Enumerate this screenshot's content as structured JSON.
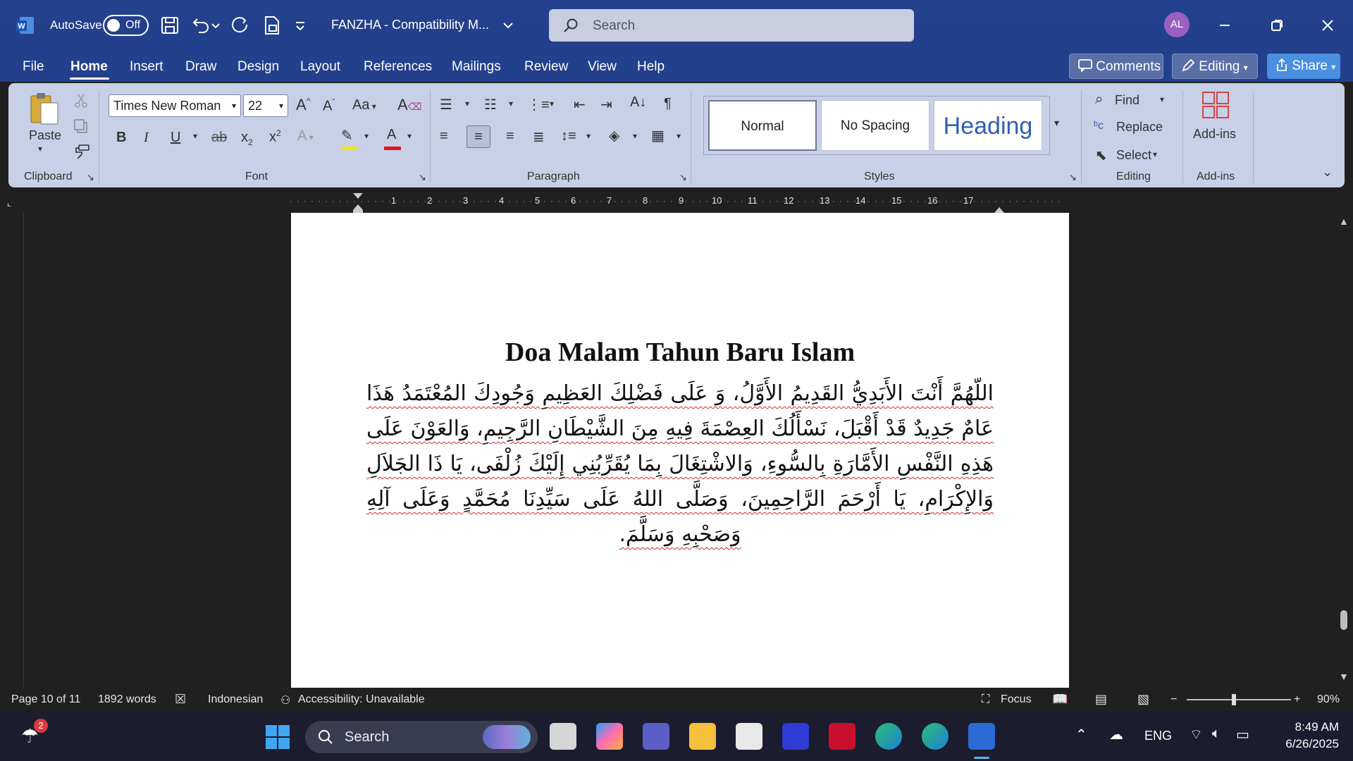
{
  "titlebar": {
    "autosave_label": "AutoSave",
    "autosave_state": "Off",
    "doc_title": "FANZHA  -  Compatibility M...",
    "search_placeholder": "Search",
    "avatar_initials": "AL"
  },
  "menu": {
    "tabs": [
      "File",
      "Home",
      "Insert",
      "Draw",
      "Design",
      "Layout",
      "References",
      "Mailings",
      "Review",
      "View",
      "Help"
    ],
    "active_tab": "Home",
    "comments_label": "Comments",
    "editing_label": "Editing",
    "share_label": "Share"
  },
  "ribbon": {
    "clipboard": {
      "paste_label": "Paste",
      "group_label": "Clipboard"
    },
    "font": {
      "font_name": "Times New Roman",
      "font_size": "22",
      "group_label": "Font",
      "highlight_color": "#f5e600",
      "font_color": "#e81123"
    },
    "paragraph": {
      "group_label": "Paragraph"
    },
    "styles": {
      "items": [
        "Normal",
        "No Spacing",
        "Heading"
      ],
      "group_label": "Styles"
    },
    "editing": {
      "find_label": "Find",
      "replace_label": "Replace",
      "select_label": "Select",
      "group_label": "Editing"
    },
    "addins": {
      "label": "Add-ins",
      "group_label": "Add-ins"
    }
  },
  "ruler": {
    "ticks": [
      "1",
      "2",
      "3",
      "4",
      "5",
      "6",
      "7",
      "8",
      "9",
      "10",
      "11",
      "12",
      "13",
      "14",
      "15",
      "16",
      "17"
    ]
  },
  "document": {
    "heading": "Doa Malam Tahun Baru Islam",
    "body": "اللّهُمَّ أَنْتَ الأَبَدِيُّ القَدِيمُ الأَوَّلُ، وَ عَلَى فَضْلِكَ العَظِيمِ وَجُودِكَ المُعْتَمَدُ هَذَا عَامٌ جَدِيدٌ قَدْ أَقْبَلَ، نَسْأَلُكَ العِصْمَةَ فِيهِ مِنَ الشَّيْطَانِ الرَّجِيمِ، وَالعَوْنَ عَلَى هَذِهِ النَّفْسِ الأَمَّارَةِ بِالسُّوءِ، وَالاشْتِغَالَ بِمَا يُقَرِّبُنِي إِلَيْكَ زُلْفَى، يَا ذَا الجَلاَلِ وَالإِكْرَامِ، يَا أَرْحَمَ الرَّاحِمِينَ، وَصَلَّى اللهُ عَلَى سَيِّدِنَا مُحَمَّدٍ وَعَلَى آلِهِ وَصَحْبِهِ وَسَلَّمَ."
  },
  "status": {
    "page": "Page 10 of 11",
    "words": "1892 words",
    "language": "Indonesian",
    "accessibility": "Accessibility: Unavailable",
    "focus": "Focus",
    "zoom": "90%"
  },
  "taskbar": {
    "weather_badge": "2",
    "search_placeholder": "Search",
    "language": "ENG",
    "time": "8:49 AM",
    "date": "6/26/2025"
  },
  "colors": {
    "titlebar": "#23408c",
    "ribbon": "#c7d0e6",
    "share": "#4a8fe0",
    "spell_underline": "#d62b2b"
  }
}
